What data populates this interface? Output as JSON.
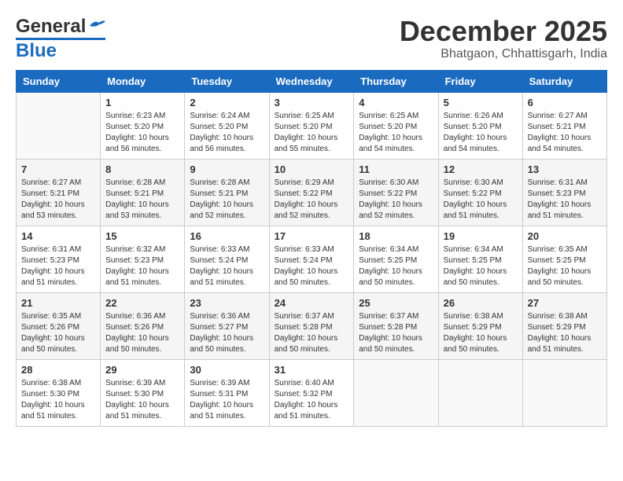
{
  "header": {
    "logo_general": "General",
    "logo_blue": "Blue",
    "month_title": "December 2025",
    "location": "Bhatgaon, Chhattisgarh, India"
  },
  "calendar": {
    "days_of_week": [
      "Sunday",
      "Monday",
      "Tuesday",
      "Wednesday",
      "Thursday",
      "Friday",
      "Saturday"
    ],
    "weeks": [
      [
        {
          "day": "",
          "info": ""
        },
        {
          "day": "1",
          "info": "Sunrise: 6:23 AM\nSunset: 5:20 PM\nDaylight: 10 hours\nand 56 minutes."
        },
        {
          "day": "2",
          "info": "Sunrise: 6:24 AM\nSunset: 5:20 PM\nDaylight: 10 hours\nand 56 minutes."
        },
        {
          "day": "3",
          "info": "Sunrise: 6:25 AM\nSunset: 5:20 PM\nDaylight: 10 hours\nand 55 minutes."
        },
        {
          "day": "4",
          "info": "Sunrise: 6:25 AM\nSunset: 5:20 PM\nDaylight: 10 hours\nand 54 minutes."
        },
        {
          "day": "5",
          "info": "Sunrise: 6:26 AM\nSunset: 5:20 PM\nDaylight: 10 hours\nand 54 minutes."
        },
        {
          "day": "6",
          "info": "Sunrise: 6:27 AM\nSunset: 5:21 PM\nDaylight: 10 hours\nand 54 minutes."
        }
      ],
      [
        {
          "day": "7",
          "info": "Sunrise: 6:27 AM\nSunset: 5:21 PM\nDaylight: 10 hours\nand 53 minutes."
        },
        {
          "day": "8",
          "info": "Sunrise: 6:28 AM\nSunset: 5:21 PM\nDaylight: 10 hours\nand 53 minutes."
        },
        {
          "day": "9",
          "info": "Sunrise: 6:28 AM\nSunset: 5:21 PM\nDaylight: 10 hours\nand 52 minutes."
        },
        {
          "day": "10",
          "info": "Sunrise: 6:29 AM\nSunset: 5:22 PM\nDaylight: 10 hours\nand 52 minutes."
        },
        {
          "day": "11",
          "info": "Sunrise: 6:30 AM\nSunset: 5:22 PM\nDaylight: 10 hours\nand 52 minutes."
        },
        {
          "day": "12",
          "info": "Sunrise: 6:30 AM\nSunset: 5:22 PM\nDaylight: 10 hours\nand 51 minutes."
        },
        {
          "day": "13",
          "info": "Sunrise: 6:31 AM\nSunset: 5:23 PM\nDaylight: 10 hours\nand 51 minutes."
        }
      ],
      [
        {
          "day": "14",
          "info": "Sunrise: 6:31 AM\nSunset: 5:23 PM\nDaylight: 10 hours\nand 51 minutes."
        },
        {
          "day": "15",
          "info": "Sunrise: 6:32 AM\nSunset: 5:23 PM\nDaylight: 10 hours\nand 51 minutes."
        },
        {
          "day": "16",
          "info": "Sunrise: 6:33 AM\nSunset: 5:24 PM\nDaylight: 10 hours\nand 51 minutes."
        },
        {
          "day": "17",
          "info": "Sunrise: 6:33 AM\nSunset: 5:24 PM\nDaylight: 10 hours\nand 50 minutes."
        },
        {
          "day": "18",
          "info": "Sunrise: 6:34 AM\nSunset: 5:25 PM\nDaylight: 10 hours\nand 50 minutes."
        },
        {
          "day": "19",
          "info": "Sunrise: 6:34 AM\nSunset: 5:25 PM\nDaylight: 10 hours\nand 50 minutes."
        },
        {
          "day": "20",
          "info": "Sunrise: 6:35 AM\nSunset: 5:25 PM\nDaylight: 10 hours\nand 50 minutes."
        }
      ],
      [
        {
          "day": "21",
          "info": "Sunrise: 6:35 AM\nSunset: 5:26 PM\nDaylight: 10 hours\nand 50 minutes."
        },
        {
          "day": "22",
          "info": "Sunrise: 6:36 AM\nSunset: 5:26 PM\nDaylight: 10 hours\nand 50 minutes."
        },
        {
          "day": "23",
          "info": "Sunrise: 6:36 AM\nSunset: 5:27 PM\nDaylight: 10 hours\nand 50 minutes."
        },
        {
          "day": "24",
          "info": "Sunrise: 6:37 AM\nSunset: 5:28 PM\nDaylight: 10 hours\nand 50 minutes."
        },
        {
          "day": "25",
          "info": "Sunrise: 6:37 AM\nSunset: 5:28 PM\nDaylight: 10 hours\nand 50 minutes."
        },
        {
          "day": "26",
          "info": "Sunrise: 6:38 AM\nSunset: 5:29 PM\nDaylight: 10 hours\nand 50 minutes."
        },
        {
          "day": "27",
          "info": "Sunrise: 6:38 AM\nSunset: 5:29 PM\nDaylight: 10 hours\nand 51 minutes."
        }
      ],
      [
        {
          "day": "28",
          "info": "Sunrise: 6:38 AM\nSunset: 5:30 PM\nDaylight: 10 hours\nand 51 minutes."
        },
        {
          "day": "29",
          "info": "Sunrise: 6:39 AM\nSunset: 5:30 PM\nDaylight: 10 hours\nand 51 minutes."
        },
        {
          "day": "30",
          "info": "Sunrise: 6:39 AM\nSunset: 5:31 PM\nDaylight: 10 hours\nand 51 minutes."
        },
        {
          "day": "31",
          "info": "Sunrise: 6:40 AM\nSunset: 5:32 PM\nDaylight: 10 hours\nand 51 minutes."
        },
        {
          "day": "",
          "info": ""
        },
        {
          "day": "",
          "info": ""
        },
        {
          "day": "",
          "info": ""
        }
      ]
    ]
  }
}
